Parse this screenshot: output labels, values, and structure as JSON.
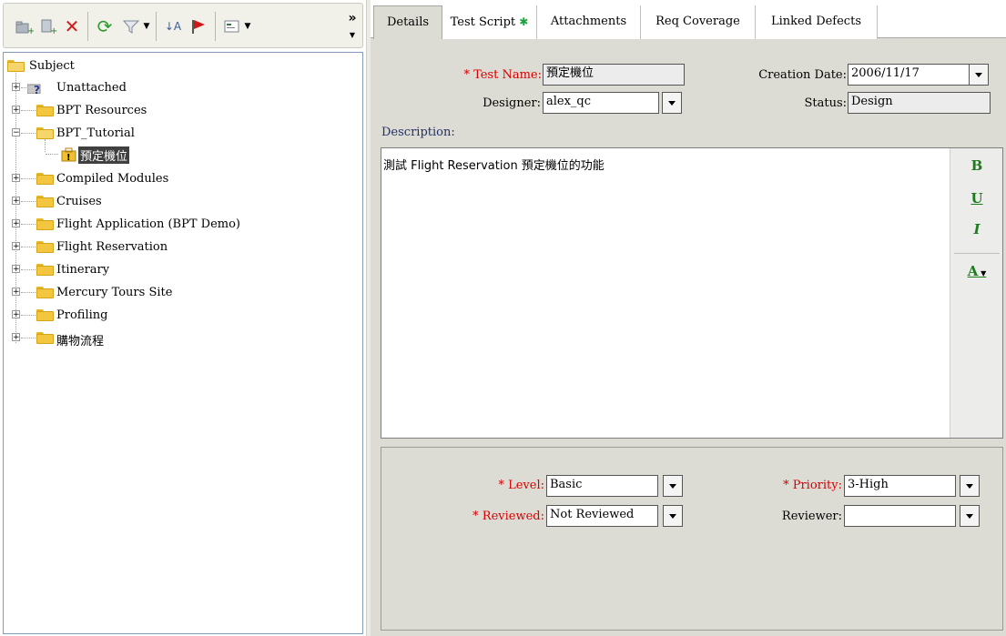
{
  "toolbar": {
    "overflow_label": "»"
  },
  "tree": {
    "root": "Subject",
    "items": [
      {
        "label": "Unattached"
      },
      {
        "label": "BPT Resources"
      },
      {
        "label": "BPT_Tutorial"
      },
      {
        "label": "預定機位"
      },
      {
        "label": "Compiled Modules"
      },
      {
        "label": "Cruises"
      },
      {
        "label": "Flight Application (BPT Demo)"
      },
      {
        "label": "Flight Reservation"
      },
      {
        "label": "Itinerary"
      },
      {
        "label": "Mercury Tours Site"
      },
      {
        "label": "Profiling"
      },
      {
        "label": "購物流程"
      }
    ]
  },
  "tabs": [
    {
      "label": "Details"
    },
    {
      "label": "Test Script"
    },
    {
      "label": "Attachments"
    },
    {
      "label": "Req Coverage"
    },
    {
      "label": "Linked Defects"
    }
  ],
  "details": {
    "test_name_label": "Test Name:",
    "test_name_value": "預定機位",
    "creation_date_label": "Creation Date:",
    "creation_date_value": "2006/11/17",
    "designer_label": "Designer:",
    "designer_value": "alex_qc",
    "status_label": "Status:",
    "status_value": "Design",
    "description_label": "Description:",
    "description_value": "測試 Flight Reservation 預定機位的功能",
    "required_mark": "*"
  },
  "format_bar": {
    "bold": "B",
    "underline": "U",
    "italic": "I",
    "color": "A"
  },
  "lower": {
    "level_label": "Level:",
    "level_value": "Basic",
    "priority_label": "Priority:",
    "priority_value": "3-High",
    "reviewed_label": "Reviewed:",
    "reviewed_value": "Not Reviewed",
    "reviewer_label": "Reviewer:",
    "reviewer_value": ""
  },
  "colors": {
    "required": "#d60000",
    "selected_bg": "#d4d0c8",
    "panel_bg": "#dcdcd4",
    "folder": "#f3c640"
  }
}
